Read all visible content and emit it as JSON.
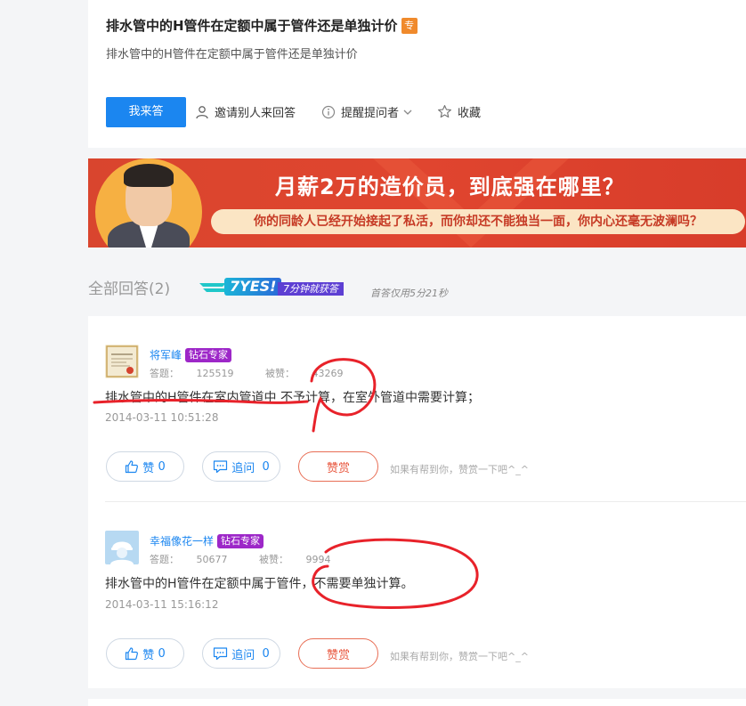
{
  "question": {
    "title": "排水管中的H管件在定额中属于管件还是单独计价",
    "badge": "专",
    "description": "排水管中的H管件在定额中属于管件还是单独计价",
    "answer_button": "我来答",
    "invite_label": "邀请别人来回答",
    "remind_label": "提醒提问者",
    "favorite_label": "收藏"
  },
  "banner": {
    "headline": "月薪2万的造价员，到底强在哪里？",
    "subtext": "你的同龄人已经开始接起了私活，而你却还不能独当一面，你内心还毫无波澜吗？"
  },
  "answers_header": {
    "title": "全部回答(2)",
    "speed_badge": "7YES!",
    "speed_tail": "7分钟就获答",
    "first_answer_note": "首答仅用5分21秒"
  },
  "answers": [
    {
      "name": "将军峰",
      "badge": "钻石专家",
      "answers_label": "答题：",
      "answers_count": "125519",
      "likes_label": "被赞：",
      "likes_count": "43269",
      "content": "排水管中的H管件在室内管道中 不予计算，在室外管道中需要计算；",
      "time": "2014-03-11 10:51:28",
      "like_label": "赞",
      "like_count": "0",
      "ask_label": "追问",
      "ask_count": "0",
      "reward_label": "赞赏",
      "hint": "如果有帮到你，赞赏一下吧^_^"
    },
    {
      "name": "幸福像花一样",
      "badge": "钻石专家",
      "answers_label": "答题：",
      "answers_count": "50677",
      "likes_label": "被赞：",
      "likes_count": "9994",
      "content": "排水管中的H管件在定额中属于管件，不需要单独计算。",
      "time": "2014-03-11 15:16:12",
      "like_label": "赞",
      "like_count": "0",
      "ask_label": "追问",
      "ask_count": "0",
      "reward_label": "赞赏",
      "hint": "如果有帮到你，赞赏一下吧^_^"
    }
  ],
  "colors": {
    "primary": "#1b86f0",
    "banner_red": "#d9452e",
    "expert_purple": "#9d27c8",
    "reward_red": "#e8553c",
    "annotation_red": "#e8222a"
  },
  "icons": {
    "invite": "person-icon",
    "remind": "info-icon",
    "favorite": "star-icon",
    "like": "thumbs-up-icon",
    "ask": "chat-icon"
  }
}
